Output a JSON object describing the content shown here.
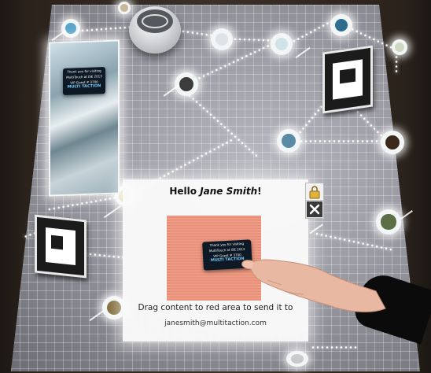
{
  "panel": {
    "greeting_prefix": "Hello ",
    "greeting_name": "Jane Smith",
    "greeting_suffix": "!",
    "instruction": "Drag content to red area to send it to",
    "email": "janesmith@multitaction.com",
    "drop_color": "#e98c73"
  },
  "cards": {
    "lines": [
      "Thank you for visiting",
      "MultiTouch at ISE 2013",
      "VIP Guest # 3700"
    ],
    "logo_top": "MULTI",
    "logo_bottom": "TACTION"
  },
  "icons": {
    "lock": "lock-icon",
    "close": "close-icon"
  },
  "colors": {
    "table": "#9a9aa3",
    "glow": "#ffffff",
    "card": "#0d1a26",
    "logo": "#7cc9f4"
  }
}
